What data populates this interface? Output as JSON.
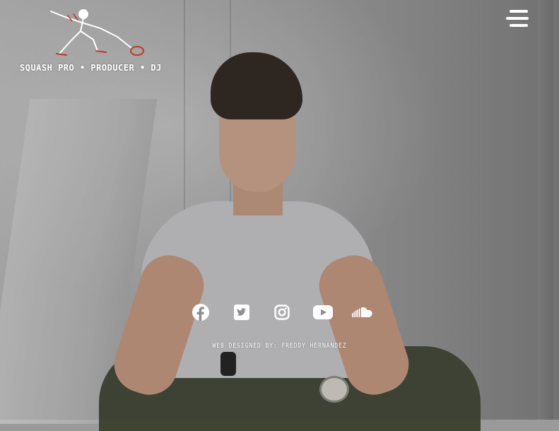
{
  "brand": {
    "tagline": "SQUASH PRO • PRODUCER • DJ"
  },
  "header": {
    "menu_icon": "hamburger-menu-icon"
  },
  "social_links": [
    {
      "name": "facebook",
      "icon": "facebook-icon"
    },
    {
      "name": "twitter",
      "icon": "twitter-icon"
    },
    {
      "name": "instagram",
      "icon": "instagram-icon"
    },
    {
      "name": "youtube",
      "icon": "youtube-icon"
    },
    {
      "name": "soundcloud",
      "icon": "soundcloud-icon"
    }
  ],
  "footer": {
    "credit": "WEB DESIGNED BY: FREDDY HERNANDEZ"
  },
  "colors": {
    "text": "#ffffff",
    "accent_red": "#c0392b"
  }
}
